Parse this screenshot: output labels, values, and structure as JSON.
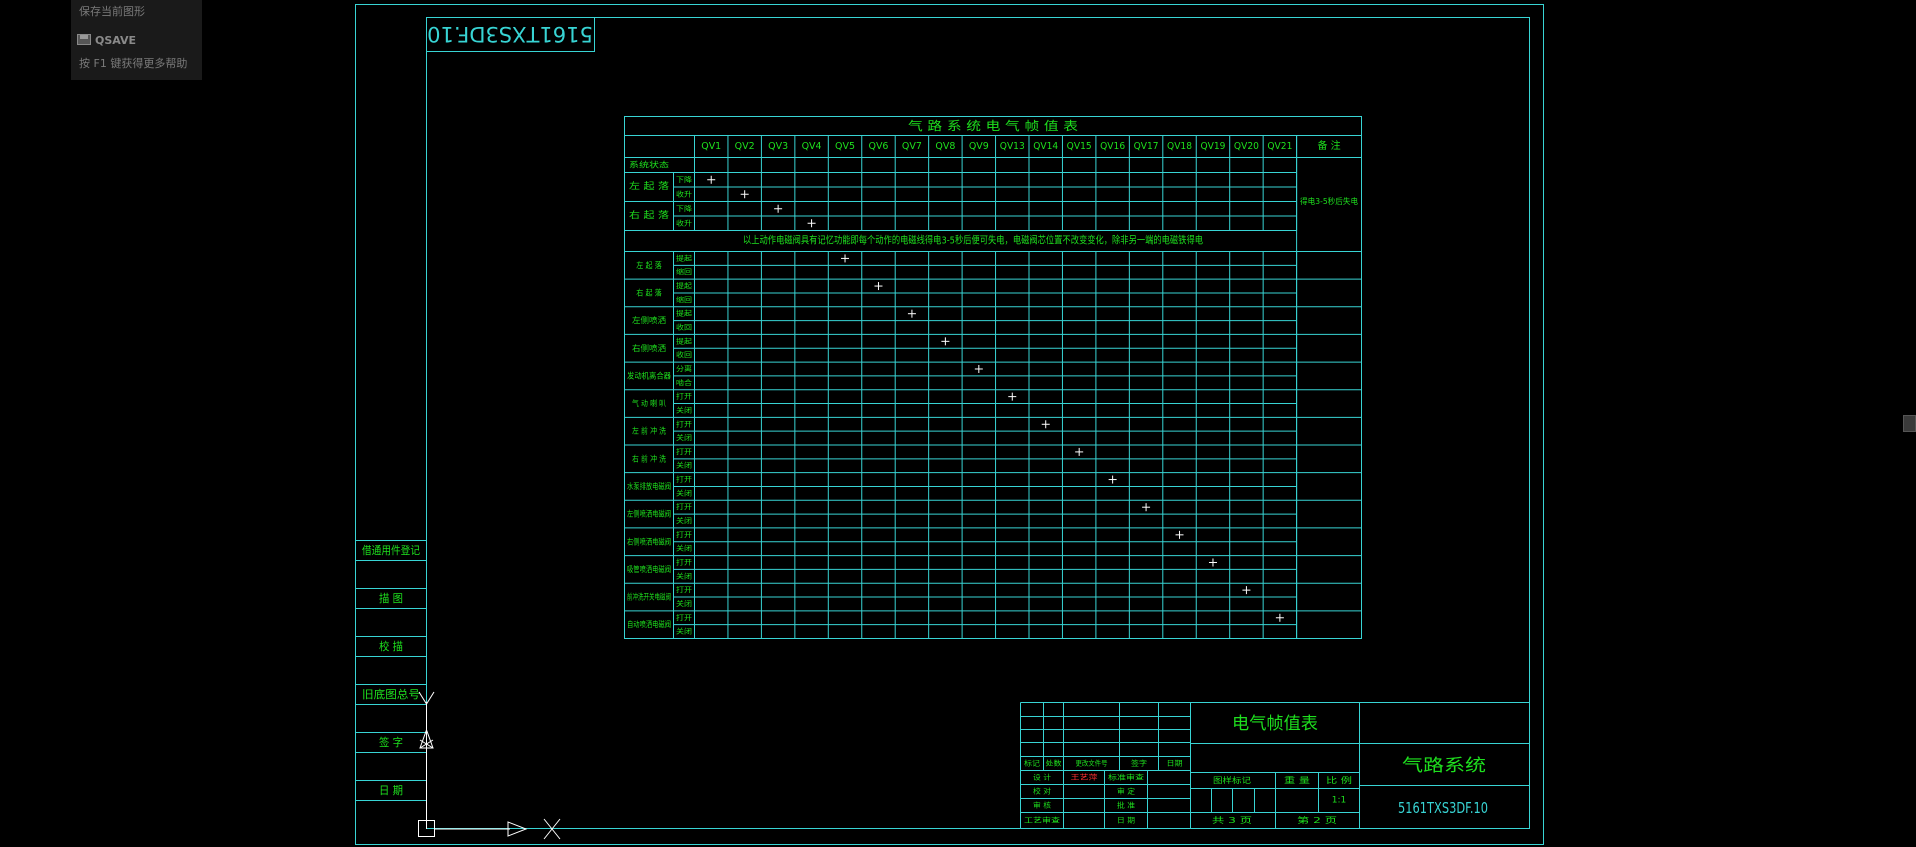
{
  "tooltip": {
    "title": "保存当前图形",
    "command": "QSAVE",
    "help": "按 F1 键获得更多帮助"
  },
  "drawing": {
    "mirrored_code": "5161TXS3DF.10",
    "table_title": "气 路 系 统 电 气 帧 值 表",
    "columns": [
      "QV1",
      "QV2",
      "QV3",
      "QV4",
      "QV5",
      "QV6",
      "QV7",
      "QV8",
      "QV9",
      "QV13",
      "QV14",
      "QV15",
      "QV16",
      "QV17",
      "QV18",
      "QV19",
      "QV20",
      "QV21"
    ],
    "remarks_header": "备 注",
    "top_header_row": "系统状态",
    "top_groups": [
      {
        "label": "左 起 落",
        "states": [
          "下降",
          "收升"
        ]
      },
      {
        "label": "右 起 落",
        "states": [
          "下降",
          "收升"
        ]
      }
    ],
    "top_marks": [
      0,
      1,
      2,
      3
    ],
    "top_remark": "得电3-5秒后失电",
    "note_row": "以上动作电磁阀具有记忆功能即每个动作的电磁线得电3-5秒后便可失电，电磁阀芯位置不改变变化，除非另一端的电磁铁得电",
    "bottom_groups": [
      {
        "label": "左 起 落",
        "states": [
          "提起",
          "缩回"
        ]
      },
      {
        "label": "右 起 落",
        "states": [
          "提起",
          "缩回"
        ]
      },
      {
        "label": "左侧喷洒",
        "states": [
          "提起",
          "收回"
        ]
      },
      {
        "label": "右侧喷洒",
        "states": [
          "提起",
          "收回"
        ]
      },
      {
        "label": "发动机离合器",
        "states": [
          "分离",
          "啮合"
        ]
      },
      {
        "label": "气 动 喇 叭",
        "states": [
          "打开",
          "关闭"
        ]
      },
      {
        "label": "左 前 冲 洗",
        "states": [
          "打开",
          "关闭"
        ]
      },
      {
        "label": "右 前 冲 洗",
        "states": [
          "打开",
          "关闭"
        ]
      },
      {
        "label": "水泵排放电磁阀",
        "states": [
          "打开",
          "关闭"
        ]
      },
      {
        "label": "左侧喷洒电磁阀",
        "states": [
          "打开",
          "关闭"
        ]
      },
      {
        "label": "右侧喷洒电磁阀",
        "states": [
          "打开",
          "关闭"
        ]
      },
      {
        "label": "吸管喷洒电磁阀",
        "states": [
          "打开",
          "关闭"
        ]
      },
      {
        "label": "前冲洗开关电磁阀",
        "states": [
          "打开",
          "关闭"
        ]
      },
      {
        "label": "自动喷洒电磁阀",
        "states": [
          "打开",
          "关闭"
        ]
      }
    ],
    "left_panel": [
      "借通用件登记",
      "描 图",
      "校 描",
      "旧底图总号",
      "签 字",
      "日 期"
    ],
    "title_block": {
      "drawing_name": "电气帧值表",
      "system_name": "气路系统",
      "drawing_code": "5161TXS3DF.10",
      "rev_headers": [
        "标记",
        "处数",
        "更改文件号",
        "签字",
        "日期"
      ],
      "design_label": "设 计",
      "designer": "王艺萍",
      "std_review": "标准审查",
      "proofread": "校 对",
      "review": "审 定",
      "audit": "审 核",
      "approve": "批 准",
      "process_audit": "工艺审查",
      "date_label": "日 期",
      "stage_mark": "图样标记",
      "weight": "重 量",
      "scale_label": "比 例",
      "scale": "1:1",
      "total_pages": "共 3 页",
      "page_no": "第 2 页"
    }
  },
  "colors": {
    "background": "#000000",
    "line_cyan": "#38d4d4",
    "text_green": "#1ee01e",
    "mark_white": "#ffffff",
    "designer_red": "#ff3030"
  }
}
